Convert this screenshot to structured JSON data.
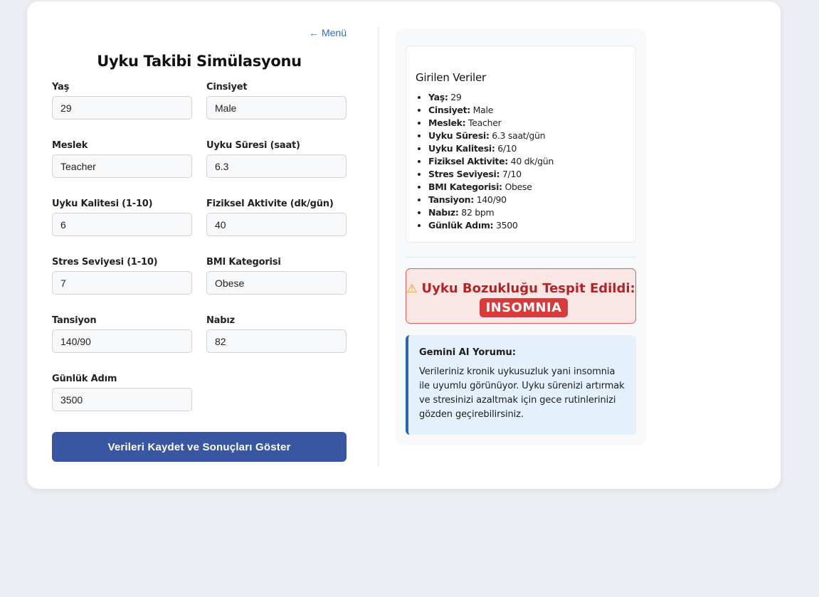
{
  "nav": {
    "menu_link": "← Menü"
  },
  "form": {
    "title": "Uyku Takibi Simülasyonu",
    "fields": {
      "age": {
        "label": "Yaş",
        "value": "29"
      },
      "gender": {
        "label": "Cinsiyet",
        "value": "Male"
      },
      "job": {
        "label": "Meslek",
        "value": "Teacher"
      },
      "duration": {
        "label": "Uyku Süresi (saat)",
        "value": "6.3"
      },
      "quality": {
        "label": "Uyku Kalitesi (1-10)",
        "value": "6"
      },
      "activity": {
        "label": "Fiziksel Aktivite (dk/gün)",
        "value": "40"
      },
      "stress": {
        "label": "Stres Seviyesi (1-10)",
        "value": "7"
      },
      "bmi": {
        "label": "BMI Kategorisi",
        "value": "Obese"
      },
      "bp": {
        "label": "Tansiyon",
        "value": "140/90"
      },
      "pulse": {
        "label": "Nabız",
        "value": "82"
      },
      "steps": {
        "label": "Günlük Adım",
        "value": "3500"
      }
    },
    "submit_label": "Verileri Kaydet ve Sonuçları Göster"
  },
  "results": {
    "entered_title": "Girilen Veriler",
    "entries": [
      {
        "key": "Yaş:",
        "value": "29"
      },
      {
        "key": "Cinsiyet:",
        "value": "Male"
      },
      {
        "key": "Meslek:",
        "value": "Teacher"
      },
      {
        "key": "Uyku Süresi:",
        "value": "6.3 saat/gün"
      },
      {
        "key": "Uyku Kalitesi:",
        "value": "6/10"
      },
      {
        "key": "Fiziksel Aktivite:",
        "value": "40 dk/gün"
      },
      {
        "key": "Stres Seviyesi:",
        "value": "7/10"
      },
      {
        "key": "BMI Kategorisi:",
        "value": "Obese"
      },
      {
        "key": "Tansiyon:",
        "value": "140/90"
      },
      {
        "key": "Nabız:",
        "value": "82 bpm"
      },
      {
        "key": "Günlük Adım:",
        "value": "3500"
      }
    ],
    "alert": {
      "icon": "warning-icon",
      "text": "Uyku Bozukluğu Tespit Edildi:",
      "diagnosis": "INSOMNIA"
    },
    "ai": {
      "title": "Gemini AI Yorumu:",
      "text": "Verileriniz kronik uykusuzluk yani insomnia ile uyumlu görünüyor. Uyku sürenizi artırmak ve stresinizi azaltmak için gece rutinlerinizi gözden geçirebilirsiniz."
    }
  },
  "colors": {
    "background": "#eceef3",
    "primary_button": "#3956a3",
    "link": "#2d6cc0",
    "alert_text": "#b42424",
    "alert_badge": "#d93a3a",
    "ai_border": "#2b66b5",
    "ai_background": "#e4f0fb"
  }
}
